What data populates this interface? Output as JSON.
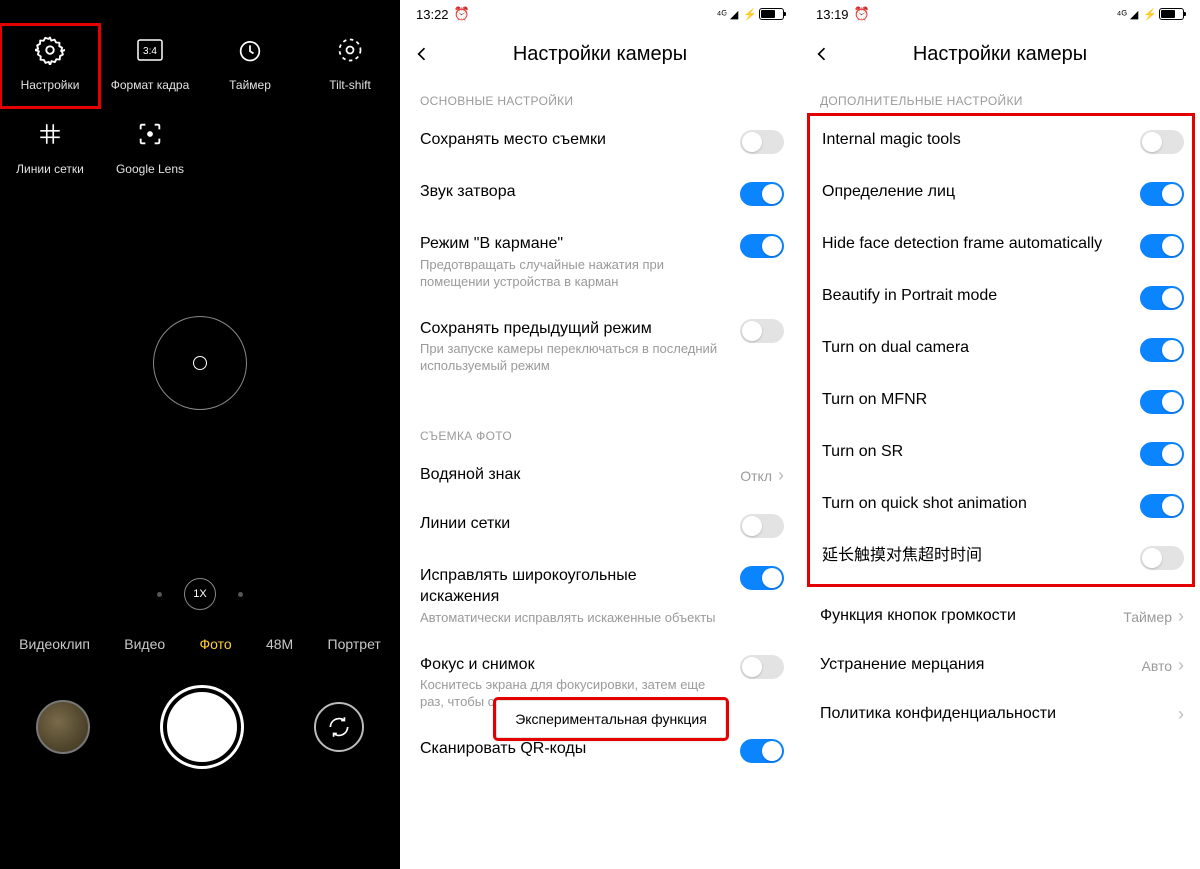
{
  "camera": {
    "top_icons": [
      {
        "name": "settings",
        "label": "Настройки",
        "highlight": true
      },
      {
        "name": "aspect-ratio",
        "label": "Формат кадра",
        "highlight": false
      },
      {
        "name": "timer",
        "label": "Таймер",
        "highlight": false
      },
      {
        "name": "tilt-shift",
        "label": "Tilt-shift",
        "highlight": false
      },
      {
        "name": "gridlines",
        "label": "Линии сетки",
        "highlight": false
      },
      {
        "name": "google-lens",
        "label": "Google Lens",
        "highlight": false
      }
    ],
    "zoom_label": "1X",
    "modes": [
      "Видеоклип",
      "Видео",
      "Фото",
      "48M",
      "Портрет"
    ],
    "mode_active": "Фото"
  },
  "settings2": {
    "status_time": "13:22",
    "battery": "57",
    "title": "Настройки камеры",
    "section1": "ОСНОВНЫЕ НАСТРОЙКИ",
    "items1": [
      {
        "label": "Сохранять место съемки",
        "sub": "",
        "toggle": false
      },
      {
        "label": "Звук затвора",
        "sub": "",
        "toggle": true
      },
      {
        "label": "Режим \"В кармане\"",
        "sub": "Предотвращать случайные нажатия при помещении устройства в карман",
        "toggle": true
      },
      {
        "label": "Сохранять предыдущий режим",
        "sub": "При запуске камеры переключаться в последний используемый режим",
        "toggle": false
      }
    ],
    "section2": "СЪЕМКА ФОТО",
    "items2": [
      {
        "label": "Водяной знак",
        "value": "Откл",
        "chevron": true
      },
      {
        "label": "Линии сетки",
        "toggle": false
      },
      {
        "label": "Исправлять широкоугольные искажения",
        "sub": "Автоматически исправлять искаженные объекты",
        "toggle": true
      },
      {
        "label": "Фокус и снимок",
        "sub": "Коснитесь экрана для фокусировки, затем еще раз, чтобы сделать снимок",
        "toggle": false
      },
      {
        "label": "Сканировать QR-коды",
        "toggle": true,
        "partial": true
      }
    ],
    "popup": "Экспериментальная функция"
  },
  "settings3": {
    "status_time": "13:19",
    "battery": "57",
    "title": "Настройки камеры",
    "section1": "ДОПОЛНИТЕЛЬНЫЕ НАСТРОЙКИ",
    "group_items": [
      {
        "label": "Internal magic tools",
        "toggle": false
      },
      {
        "label": "Определение лиц",
        "toggle": true
      },
      {
        "label": "Hide face detection frame automatically",
        "toggle": true
      },
      {
        "label": "Beautify in Portrait mode",
        "toggle": true
      },
      {
        "label": "Turn on dual camera",
        "toggle": true
      },
      {
        "label": "Turn on MFNR",
        "toggle": true
      },
      {
        "label": "Turn on SR",
        "toggle": true
      },
      {
        "label": "Turn on quick shot animation",
        "toggle": true
      },
      {
        "label": "延长触摸对焦超时时间",
        "toggle": false
      }
    ],
    "after_items": [
      {
        "label": "Функция кнопок громкости",
        "value": "Таймер",
        "chevron": true
      },
      {
        "label": "Устранение мерцания",
        "value": "Авто",
        "chevron": true
      },
      {
        "label": "Политика конфиденциальности",
        "chevron": true
      }
    ]
  }
}
